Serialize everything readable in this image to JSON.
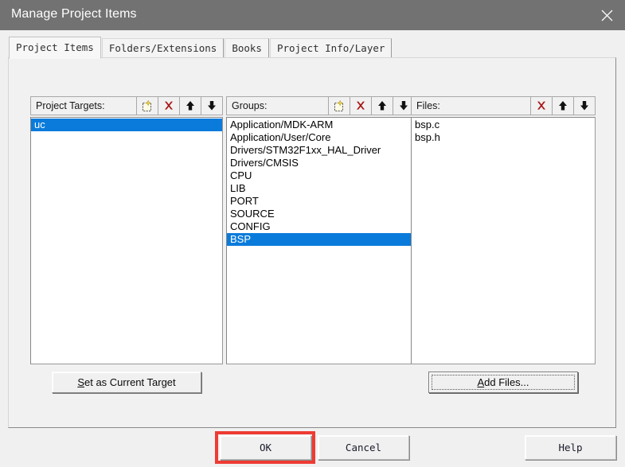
{
  "window": {
    "title": "Manage Project Items",
    "close_icon": "close-icon",
    "titlebar_color": "#727272"
  },
  "tabs": [
    {
      "label": "Project Items",
      "active": true
    },
    {
      "label": "Folders/Extensions",
      "active": false
    },
    {
      "label": "Books",
      "active": false
    },
    {
      "label": "Project Info/Layer",
      "active": false
    }
  ],
  "panels": {
    "project_targets": {
      "header_label": "Project Targets:",
      "toolbar": [
        {
          "icon": "new-item-icon",
          "name": "new-target-button"
        },
        {
          "icon": "delete-x-icon",
          "name": "delete-target-button"
        },
        {
          "icon": "arrow-up-icon",
          "name": "move-target-up-button"
        },
        {
          "icon": "arrow-down-icon",
          "name": "move-target-down-button"
        }
      ],
      "items": [
        {
          "label": "uc",
          "selected": true
        }
      ]
    },
    "groups": {
      "header_label": "Groups:",
      "toolbar": [
        {
          "icon": "new-item-icon",
          "name": "new-group-button"
        },
        {
          "icon": "delete-x-icon",
          "name": "delete-group-button"
        },
        {
          "icon": "arrow-up-icon",
          "name": "move-group-up-button"
        },
        {
          "icon": "arrow-down-icon",
          "name": "move-group-down-button"
        }
      ],
      "items": [
        {
          "label": "Application/MDK-ARM",
          "selected": false
        },
        {
          "label": "Application/User/Core",
          "selected": false
        },
        {
          "label": "Drivers/STM32F1xx_HAL_Driver",
          "selected": false
        },
        {
          "label": "Drivers/CMSIS",
          "selected": false
        },
        {
          "label": "CPU",
          "selected": false
        },
        {
          "label": "LIB",
          "selected": false
        },
        {
          "label": "PORT",
          "selected": false
        },
        {
          "label": "SOURCE",
          "selected": false
        },
        {
          "label": "CONFIG",
          "selected": false
        },
        {
          "label": "BSP",
          "selected": true
        }
      ]
    },
    "files": {
      "header_label": "Files:",
      "toolbar": [
        {
          "icon": "delete-x-icon",
          "name": "delete-file-button"
        },
        {
          "icon": "arrow-up-icon",
          "name": "move-file-up-button"
        },
        {
          "icon": "arrow-down-icon",
          "name": "move-file-down-button"
        }
      ],
      "items": [
        {
          "label": "bsp.c",
          "selected": false
        },
        {
          "label": "bsp.h",
          "selected": false
        }
      ]
    }
  },
  "buttons": {
    "set_as_current_target": {
      "mnemonic": "S",
      "rest": "et as Current Target"
    },
    "add_files": {
      "mnemonic": "A",
      "rest": "dd Files..."
    },
    "ok": "OK",
    "cancel": "Cancel",
    "help": "Help"
  },
  "annotation": {
    "target": "ok-button",
    "color": "#ee3b33"
  },
  "colors": {
    "selection_blue": "#0a7bdb",
    "dialog_face": "#f0f0f0",
    "titlebar_gray": "#727272",
    "delete_icon_red": "#a81616"
  }
}
